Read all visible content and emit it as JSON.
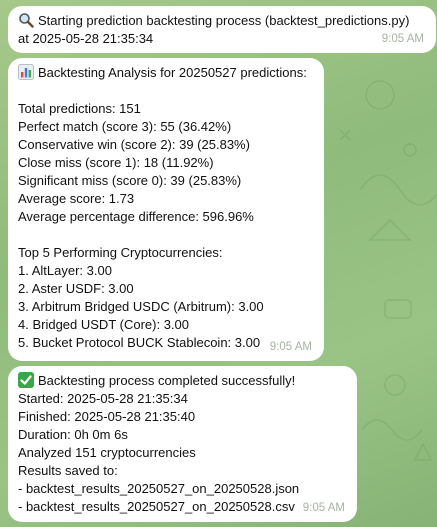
{
  "messages": [
    {
      "icon": "magnifier-icon",
      "lines": [
        "Starting prediction backtesting process (backtest_predictions.py)",
        "at 2025-05-28 21:35:34"
      ],
      "time": "9:05 AM"
    },
    {
      "icon": "bar-chart-icon",
      "lines": [
        "Backtesting Analysis for 20250527 predictions:",
        "",
        "Total predictions: 151",
        "Perfect match (score 3): 55 (36.42%)",
        "Conservative win (score 2): 39 (25.83%)",
        "Close miss (score 1): 18 (11.92%)",
        "Significant miss (score 0): 39 (25.83%)",
        "Average score: 1.73",
        "Average percentage difference: 596.96%",
        "",
        "Top 5 Performing Cryptocurrencies:",
        "1. AltLayer: 3.00",
        "2. Aster USDF: 3.00",
        "3. Arbitrum Bridged USDC (Arbitrum): 3.00",
        "4. Bridged USDT (Core): 3.00",
        "5. Bucket Protocol BUCK Stablecoin: 3.00"
      ],
      "time": "9:05 AM"
    },
    {
      "icon": "check-mark-icon",
      "lines": [
        "Backtesting process completed successfully!",
        "Started: 2025-05-28 21:35:34",
        "Finished: 2025-05-28 21:35:40",
        "Duration: 0h 0m 6s",
        "Analyzed 151 cryptocurrencies",
        "Results saved to:",
        "- backtest_results_20250527_on_20250528.json",
        "- backtest_results_20250527_on_20250528.csv"
      ],
      "time": "9:05 AM"
    }
  ],
  "colors": {
    "wallpaper": "#9cc487",
    "bubble": "#ffffff",
    "timestamp": "#a8b3a2",
    "check_emoji": "#3aa64a"
  }
}
